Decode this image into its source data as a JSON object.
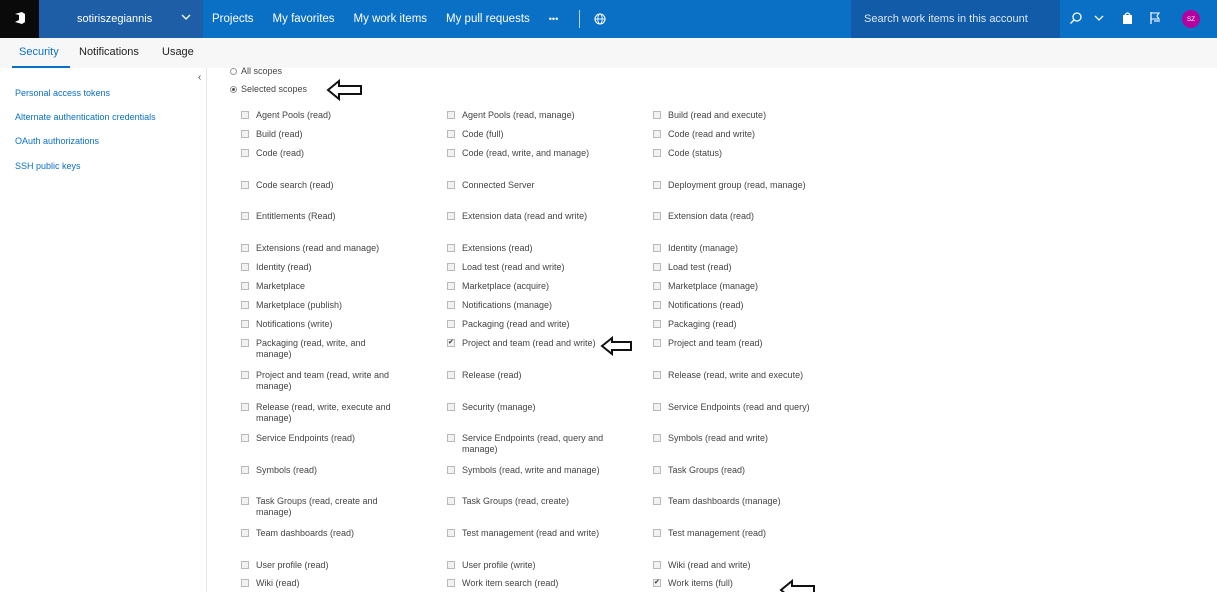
{
  "topbar": {
    "account": "sotiriszegiannis",
    "nav": [
      "Projects",
      "My favorites",
      "My work items",
      "My pull requests",
      "•••"
    ],
    "search_placeholder": "Search work items in this account",
    "avatar_initials": "SZ",
    "colors": {
      "bar": "#0a70c6",
      "account_bg": "#1e5ea6",
      "avatar": "#b4009e"
    }
  },
  "tabs": [
    "Security",
    "Notifications",
    "Usage"
  ],
  "sidebar": {
    "collapse": "‹",
    "items": [
      "Personal access tokens",
      "Alternate authentication credentials",
      "OAuth authorizations",
      "SSH public keys"
    ]
  },
  "scopes_choice": {
    "all": "All scopes",
    "selected": "Selected scopes",
    "selected_value": "Selected scopes"
  },
  "scopes": {
    "col1": [
      {
        "label": "Agent Pools (read)",
        "checked": false
      },
      {
        "label": "Build (read)",
        "checked": false
      },
      {
        "label": "Code (read)",
        "checked": false
      },
      {
        "label": "Code search (read)",
        "checked": false
      },
      {
        "label": "Entitlements (Read)",
        "checked": false
      },
      {
        "label": "Extensions (read and manage)",
        "checked": false
      },
      {
        "label": "Identity (read)",
        "checked": false
      },
      {
        "label": "Marketplace",
        "checked": false
      },
      {
        "label": "Marketplace (publish)",
        "checked": false
      },
      {
        "label": "Notifications (write)",
        "checked": false
      },
      {
        "label": "Packaging (read, write, and manage)",
        "checked": false
      },
      {
        "label": "Project and team (read, write and manage)",
        "checked": false
      },
      {
        "label": "Release (read, write, execute and manage)",
        "checked": false
      },
      {
        "label": "Service Endpoints (read)",
        "checked": false
      },
      {
        "label": "Symbols (read)",
        "checked": false
      },
      {
        "label": "Task Groups (read, create and manage)",
        "checked": false
      },
      {
        "label": "Team dashboards (read)",
        "checked": false
      },
      {
        "label": "User profile (read)",
        "checked": false
      },
      {
        "label": "Wiki (read)",
        "checked": false
      }
    ],
    "col2": [
      {
        "label": "Agent Pools (read, manage)",
        "checked": false
      },
      {
        "label": "Code (full)",
        "checked": false
      },
      {
        "label": "Code (read, write, and manage)",
        "checked": false
      },
      {
        "label": "Connected Server",
        "checked": false
      },
      {
        "label": "Extension data (read and write)",
        "checked": false
      },
      {
        "label": "Extensions (read)",
        "checked": false
      },
      {
        "label": "Load test (read and write)",
        "checked": false
      },
      {
        "label": "Marketplace (acquire)",
        "checked": false
      },
      {
        "label": "Notifications (manage)",
        "checked": false
      },
      {
        "label": "Packaging (read and write)",
        "checked": false
      },
      {
        "label": "Project and team (read and write)",
        "checked": true
      },
      {
        "label": "Release (read)",
        "checked": false
      },
      {
        "label": "Security (manage)",
        "checked": false
      },
      {
        "label": "Service Endpoints (read, query and manage)",
        "checked": false
      },
      {
        "label": "Symbols (read, write and manage)",
        "checked": false
      },
      {
        "label": "Task Groups (read, create)",
        "checked": false
      },
      {
        "label": "Test management (read and write)",
        "checked": false
      },
      {
        "label": "User profile (write)",
        "checked": false
      },
      {
        "label": "Work item search (read)",
        "checked": false
      }
    ],
    "col3": [
      {
        "label": "Build (read and execute)",
        "checked": false
      },
      {
        "label": "Code (read and write)",
        "checked": false
      },
      {
        "label": "Code (status)",
        "checked": false
      },
      {
        "label": "Deployment group (read, manage)",
        "checked": false
      },
      {
        "label": "Extension data (read)",
        "checked": false
      },
      {
        "label": "Identity (manage)",
        "checked": false
      },
      {
        "label": "Load test (read)",
        "checked": false
      },
      {
        "label": "Marketplace (manage)",
        "checked": false
      },
      {
        "label": "Notifications (read)",
        "checked": false
      },
      {
        "label": "Packaging (read)",
        "checked": false
      },
      {
        "label": "Project and team (read)",
        "checked": false
      },
      {
        "label": "Release (read, write and execute)",
        "checked": false
      },
      {
        "label": "Service Endpoints (read and query)",
        "checked": false
      },
      {
        "label": "Symbols (read and write)",
        "checked": false
      },
      {
        "label": "Task Groups (read)",
        "checked": false
      },
      {
        "label": "Team dashboards (manage)",
        "checked": false
      },
      {
        "label": "Test management (read)",
        "checked": false
      },
      {
        "label": "Wiki (read and write)",
        "checked": false
      },
      {
        "label": "Work items (full)",
        "checked": true
      }
    ]
  },
  "icons": {
    "brand": "vsts-logo-icon",
    "chevron": "chevron-down-icon",
    "globe": "globe-icon",
    "search": "search-icon",
    "notifications": "bag-icon",
    "flag": "flag-icon",
    "arrow": "hollow-arrow-left-icon"
  }
}
